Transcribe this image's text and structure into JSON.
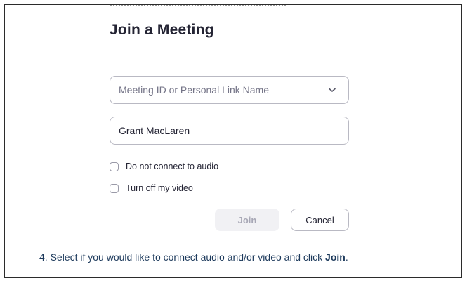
{
  "dialog": {
    "title": "Join a Meeting",
    "meeting_id": {
      "placeholder": "Meeting ID or Personal Link Name",
      "value": ""
    },
    "name_field": {
      "value": "Grant MacLaren"
    },
    "options": [
      {
        "label": "Do not connect to audio",
        "checked": false
      },
      {
        "label": "Turn off my video",
        "checked": false
      }
    ],
    "buttons": {
      "join_label": "Join",
      "cancel_label": "Cancel"
    }
  },
  "instruction": {
    "text": "4. Select if you would like to connect audio and/or video and click ",
    "emphasis": "Join",
    "suffix": "."
  },
  "icons": {
    "dropdown": "chevron-down-icon"
  },
  "colors": {
    "title": "#232333",
    "placeholder": "#747487",
    "border": "#b9b9c3",
    "join_disabled_bg": "#f1f1f4",
    "join_disabled_text": "#a7a7b5",
    "instruction_text": "#1d3a5c"
  }
}
